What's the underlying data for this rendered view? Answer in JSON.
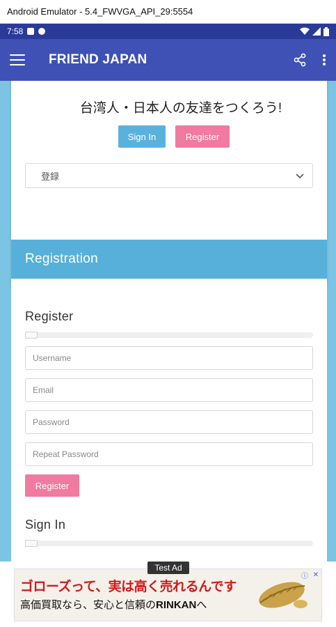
{
  "window": {
    "title": "Android Emulator - 5.4_FWVGA_API_29:5554"
  },
  "statusbar": {
    "time": "7:58"
  },
  "appbar": {
    "title": "FRIEND JAPAN"
  },
  "hero": {
    "text": "台湾人・日本人の友達をつくろう!",
    "signin_label": "Sign In",
    "register_label": "Register",
    "select_value": "登録"
  },
  "registration": {
    "header": "Registration",
    "register_title": "Register",
    "fields": {
      "username": "Username",
      "email": "Email",
      "password": "Password",
      "repeat_password": "Repeat Password"
    },
    "register_button": "Register",
    "signin_title": "Sign In"
  },
  "ad": {
    "label": "Test Ad",
    "headline": "ゴローズって、実は高く売れるんです",
    "sub_prefix": "高価買取なら、安心と信頼の",
    "sub_brand": "RINKAN",
    "sub_suffix": "へ"
  },
  "colors": {
    "appbar": "#3f51b5",
    "statusbar": "#2a3a99",
    "background": "#7cc4e3",
    "signin_button": "#5ab2dc",
    "register_button": "#f07aa0",
    "registration_header": "#57b0d9",
    "ad_headline": "#d21a1a"
  }
}
